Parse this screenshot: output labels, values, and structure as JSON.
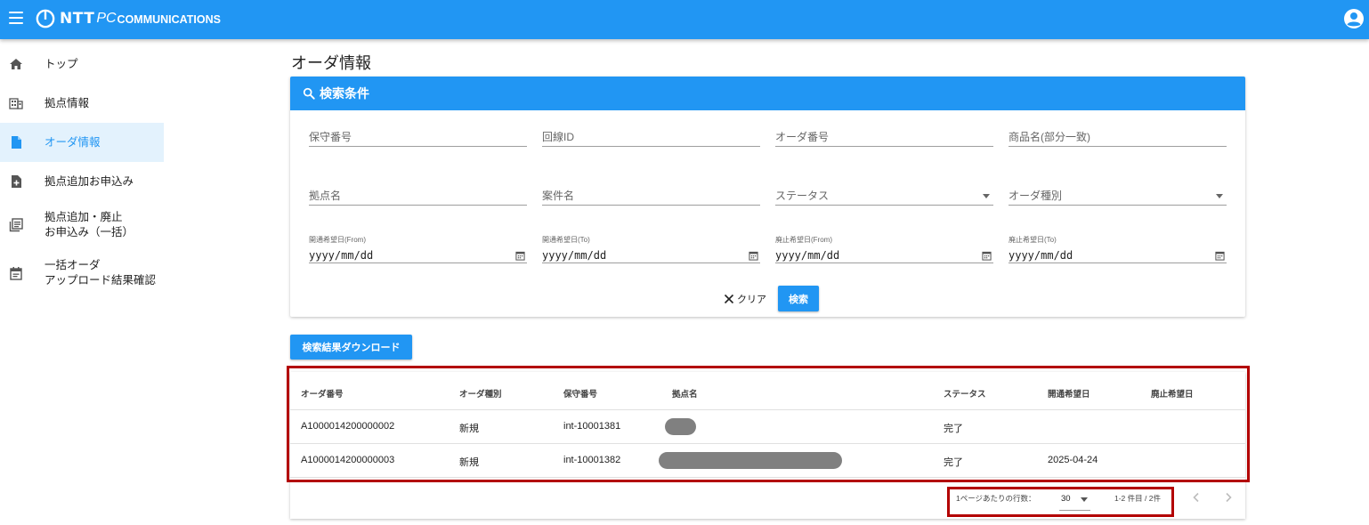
{
  "header": {
    "logo_ntt": "NTT",
    "logo_pc": "PC",
    "logo_comm": "COMMUNICATIONS",
    "menu_icon": "hamburger-menu-icon",
    "account_icon": "account-circle-icon"
  },
  "sidebar": {
    "items": [
      {
        "label": "トップ",
        "icon": "home-icon"
      },
      {
        "label": "拠点情報",
        "icon": "building-icon"
      },
      {
        "label": "オーダ情報",
        "icon": "document-icon"
      },
      {
        "label": "拠点追加お申込み",
        "icon": "document-add-icon"
      },
      {
        "label": "拠点追加・廃止\nお申込み（一括）",
        "icon": "list-stack-icon"
      },
      {
        "label": "一括オーダ\nアップロード結果確認",
        "icon": "calendar-note-icon"
      }
    ]
  },
  "page": {
    "title": "オーダ情報"
  },
  "search": {
    "title": "検索条件",
    "fields": {
      "maintenance_no": "保守番号",
      "line_id": "回線ID",
      "order_no": "オーダ番号",
      "product_name": "商品名(部分一致)",
      "site_name": "拠点名",
      "project_name": "案件名",
      "status": "ステータス",
      "order_type": "オーダ種別"
    },
    "dates": {
      "open_from_label": "開通希望日(From)",
      "open_to_label": "開通希望日(To)",
      "close_from_label": "廃止希望日(From)",
      "close_to_label": "廃止希望日(To)",
      "placeholder": "yyyy/mm/dd"
    },
    "clear_label": "クリア",
    "search_label": "検索"
  },
  "download_label": "検索結果ダウンロード",
  "table": {
    "headers": [
      "オーダ番号",
      "オーダ種別",
      "保守番号",
      "拠点名",
      "ステータス",
      "開通希望日",
      "廃止希望日"
    ],
    "rows": [
      {
        "order_no": "A1000014200000002",
        "order_type": "新規",
        "maint_no": "int-10001381",
        "status": "完了",
        "open_date": "",
        "close_date": ""
      },
      {
        "order_no": "A1000014200000003",
        "order_type": "新規",
        "maint_no": "int-10001382",
        "status": "完了",
        "open_date": "2025-04-24",
        "close_date": ""
      }
    ]
  },
  "pagination": {
    "rows_per_page_label": "1ページあたりの行数：",
    "rows_per_page": "30",
    "range": "1-2 件目 / 2件"
  },
  "colors": {
    "primary": "#2196f3",
    "highlight": "#b30000",
    "active_bg": "#e3f2fd"
  }
}
